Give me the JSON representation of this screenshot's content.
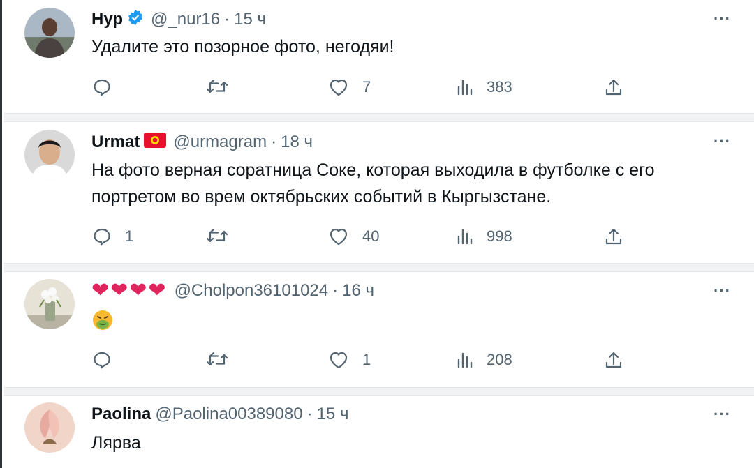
{
  "tweets": [
    {
      "name": "Нур",
      "handle": "@_nur16",
      "time": "15 ч",
      "text": "Удалите это позорное фото, негодяи!",
      "replies": "",
      "retweets": "",
      "likes": "7",
      "views": "383",
      "more": "···"
    },
    {
      "name": "Urmat",
      "handle": "@urmagram",
      "time": "18 ч",
      "text": "На фото верная соратница Соке, которая выходила в футболке с его портретом во врем октябрьских событий в Кыргызстане.",
      "replies": "1",
      "retweets": "",
      "likes": "40",
      "views": "998",
      "more": "···"
    },
    {
      "name": "",
      "handle": "@Cholpon36101024",
      "time": "16 ч",
      "text": "",
      "replies": "",
      "retweets": "",
      "likes": "1",
      "views": "208",
      "more": "···"
    },
    {
      "name": "Paolina",
      "handle": "@Paolina00389080",
      "time": "15 ч",
      "text": "Лярва",
      "more": "···"
    }
  ],
  "icons": {
    "verified_color": "#1d9bf0",
    "heart_color": "#e0245e",
    "flag_color": "#e8112d",
    "text_muted": "#536471"
  },
  "dot": "·"
}
